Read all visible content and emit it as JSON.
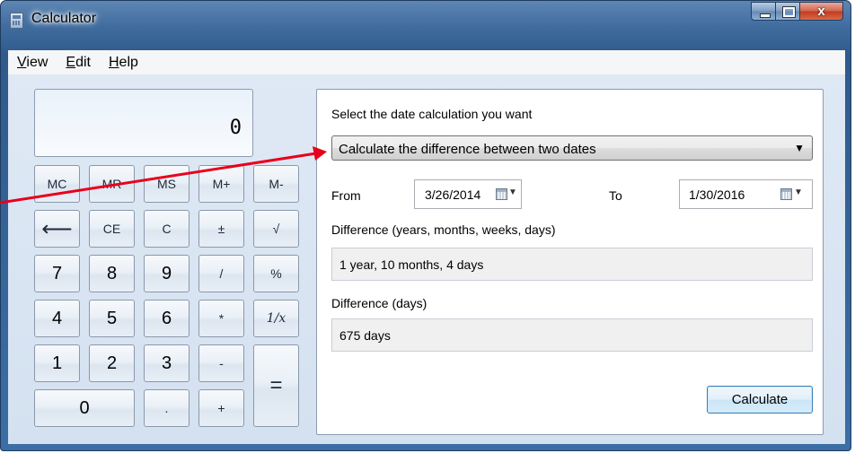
{
  "window": {
    "title": "Calculator",
    "close_glyph": "x"
  },
  "menu": [
    {
      "accel": "V",
      "rest": "iew"
    },
    {
      "accel": "E",
      "rest": "dit"
    },
    {
      "accel": "H",
      "rest": "elp"
    }
  ],
  "display": {
    "value": "0"
  },
  "keys": {
    "mc": "MC",
    "mr": "MR",
    "ms": "MS",
    "mplus": "M+",
    "mminus": "M-",
    "back": "⟵",
    "ce": "CE",
    "c": "C",
    "plusminus": "±",
    "sqrt": "√",
    "seven": "7",
    "eight": "8",
    "nine": "9",
    "divide": "/",
    "percent": "%",
    "four": "4",
    "five": "5",
    "six": "6",
    "multiply": "*",
    "reciprocal": "1/x",
    "one": "1",
    "two": "2",
    "three": "3",
    "minus": "-",
    "equals": "=",
    "zero": "0",
    "decimal": ".",
    "plus": "+"
  },
  "date_panel": {
    "prompt": "Select the date calculation you want",
    "mode": "Calculate the difference between two dates",
    "from_label": "From",
    "from_date": "3/26/2014",
    "to_label": "To",
    "to_date": "1/30/2016",
    "diff_ymwd_label": "Difference (years, months, weeks, days)",
    "diff_ymwd_value": "1 year, 10 months, 4 days",
    "diff_days_label": "Difference (days)",
    "diff_days_value": "675 days",
    "calculate_label": "Calculate"
  },
  "annotation": {
    "arrow_color": "#e8001c"
  }
}
